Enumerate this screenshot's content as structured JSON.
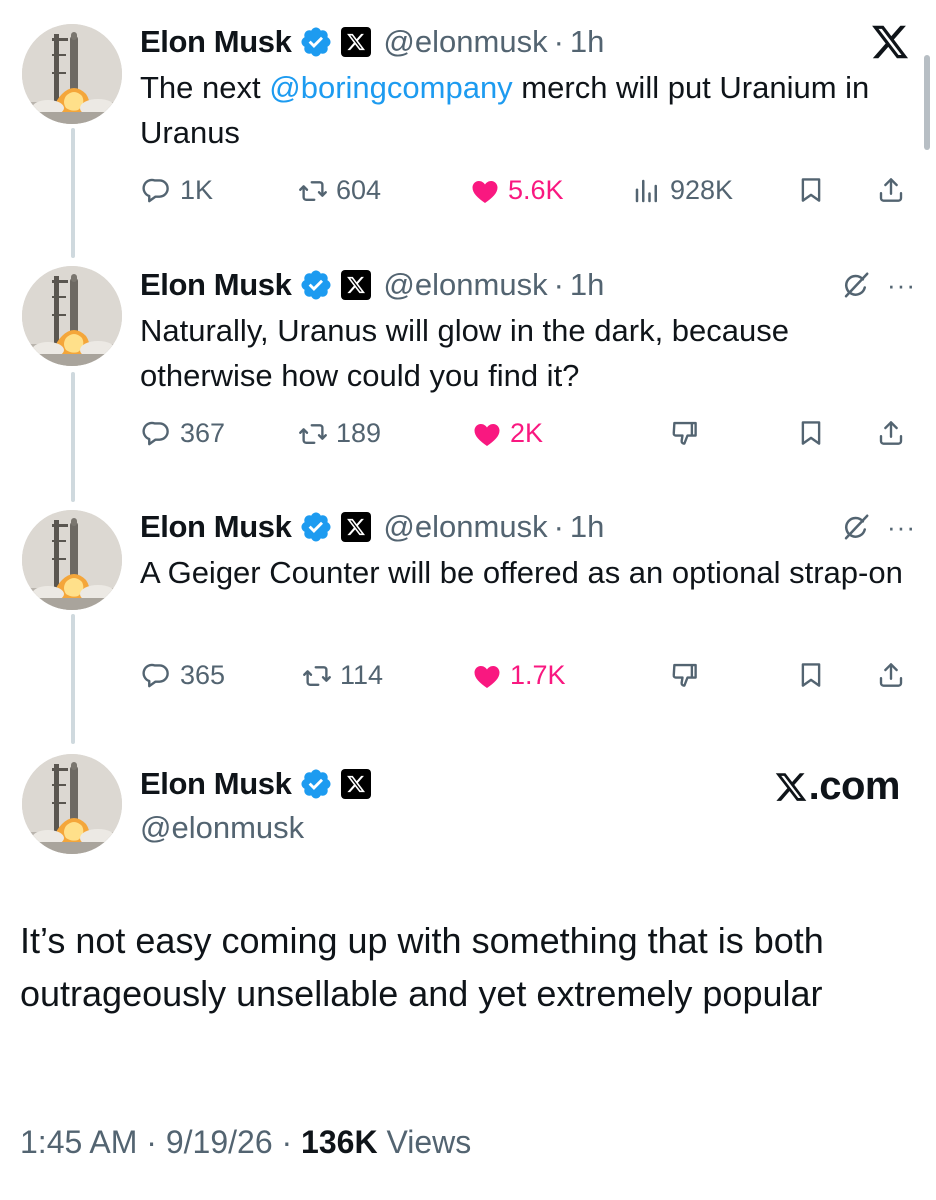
{
  "author": {
    "name": "Elon Musk",
    "handle": "@elonmusk"
  },
  "thread": [
    {
      "time": "1h",
      "text_before": "The next ",
      "mention": "@boringcompany",
      "text_after": " merch will put Uranium in Uranus",
      "replies": "1K",
      "reposts": "604",
      "likes": "5.6K",
      "views": "928K"
    },
    {
      "time": "1h",
      "text": "Naturally, Uranus will glow in the dark, because otherwise how could you find it?",
      "replies": "367",
      "reposts": "189",
      "likes": "2K"
    },
    {
      "time": "1h",
      "text": "A Geiger Counter will be offered as an optional strap-on",
      "replies": "365",
      "reposts": "114",
      "likes": "1.7K"
    }
  ],
  "main": {
    "site_label": ".com",
    "text": "It’s not easy coming up with something that is both outrageously unsellable and yet extremely popular",
    "time": "1:45 AM",
    "date": "9/19/26",
    "views_count": "136K",
    "views_label": "Views"
  },
  "separator": "·",
  "colors": {
    "accent": "#1d9bf0",
    "like": "#f91880",
    "muted": "#536471",
    "text": "#0f1419"
  },
  "icons": [
    "x-logo-icon",
    "verified-icon",
    "reply-icon",
    "repost-icon",
    "heart-icon",
    "views-icon",
    "bookmark-icon",
    "share-icon",
    "grok-icon",
    "more-icon",
    "dislike-icon"
  ]
}
